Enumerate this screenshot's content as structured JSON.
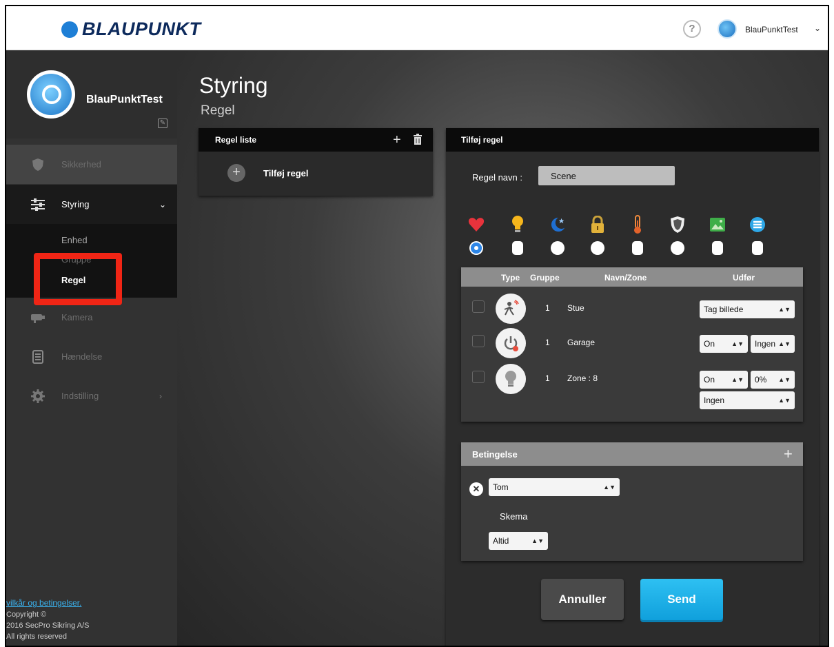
{
  "header": {
    "brand": "BLAUPUNKT",
    "help_symbol": "?",
    "user": "BlauPunktTest"
  },
  "sidebar": {
    "profile_name": "BlauPunktTest",
    "items": [
      {
        "label": "Sikkerhed",
        "icon": "shield-icon"
      },
      {
        "label": "Styring",
        "icon": "sliders-icon"
      },
      {
        "label": "Kamera",
        "icon": "camera-icon"
      },
      {
        "label": "Hændelse",
        "icon": "list-icon"
      },
      {
        "label": "Indstilling",
        "icon": "gear-icon"
      }
    ],
    "subitems": [
      "Enhed",
      "Gruppe",
      "Regel"
    ],
    "footer": {
      "link": "vilkår og betingelser.",
      "copyright": "Copyright ©",
      "company": "2016 SecPro Sikring A/S",
      "rights": "All rights reserved"
    }
  },
  "main": {
    "title": "Styring",
    "subtitle": "Regel"
  },
  "rule_list": {
    "title": "Regel liste",
    "add_label": "Tilføj regel"
  },
  "rule_form": {
    "title": "Tilføj regel",
    "name_label": "Regel navn :",
    "name_value": "Scene",
    "types": [
      {
        "icon": "heart-icon",
        "selected": true
      },
      {
        "icon": "bulb-icon",
        "selected": false
      },
      {
        "icon": "moon-icon",
        "selected": false
      },
      {
        "icon": "lock-icon",
        "selected": false
      },
      {
        "icon": "thermometer-icon",
        "selected": false
      },
      {
        "icon": "shield-icon",
        "selected": false
      },
      {
        "icon": "picture-icon",
        "selected": false
      },
      {
        "icon": "list-circle-icon",
        "selected": false
      }
    ],
    "table": {
      "headers": {
        "type": "Type",
        "group": "Gruppe",
        "name": "Navn/Zone",
        "action": "Udfør"
      },
      "rows": [
        {
          "icon": "motion-sensor-icon",
          "group": "1",
          "name": "Stue",
          "actions": [
            "Tag billede"
          ]
        },
        {
          "icon": "power-switch-icon",
          "group": "1",
          "name": "Garage",
          "actions": [
            "On",
            "Ingen"
          ]
        },
        {
          "icon": "lightbulb-icon",
          "group": "1",
          "name": "Zone : 8",
          "actions": [
            "On",
            "0%",
            "Ingen"
          ]
        }
      ]
    },
    "condition": {
      "title": "Betingelse",
      "value": "Tom",
      "schedule_label": "Skema",
      "schedule_value": "Altid"
    },
    "buttons": {
      "cancel": "Annuller",
      "send": "Send"
    }
  }
}
